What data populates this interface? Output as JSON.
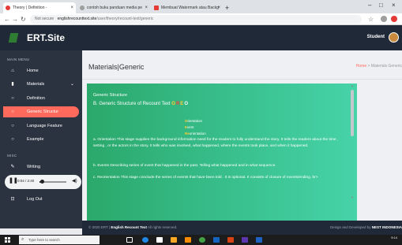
{
  "browser": {
    "tabs": [
      {
        "label": "Theory | Definition -",
        "active": true
      },
      {
        "label": "contoh buku panduan media pe",
        "active": false
      },
      {
        "label": "Membuat Watermark atau Backg",
        "active": false
      }
    ],
    "new_tab": "+",
    "url_warning": "Not secure",
    "url_host": "englishrecounttext.site",
    "url_path": "/user/theory/recount-text/generic"
  },
  "header": {
    "brand": "ERT.Site",
    "user_name": "Student"
  },
  "sidebar": {
    "section_main": "MAIN MENU",
    "items": [
      {
        "label": "Home",
        "icon": "home-icon"
      },
      {
        "label": "Materials",
        "icon": "document-icon"
      },
      {
        "label": "Definition",
        "icon": "circle-icon"
      },
      {
        "label": "Generic Structur",
        "icon": "circle-icon"
      },
      {
        "label": "Language Feature",
        "icon": "circle-icon"
      },
      {
        "label": "Example",
        "icon": "circle-icon"
      }
    ],
    "section_misc": "MISC",
    "writing_label": "Writing",
    "logout_label": "Log Out",
    "player_time": "0:04 / 2:40",
    "player_progress": 0.03
  },
  "main": {
    "title": "Materials|Generic",
    "breadcrumb_home": "Home",
    "breadcrumb_sep": ">",
    "breadcrumb_current": "Materials Generic",
    "card": {
      "heading": "Generic Structure",
      "sub_heading": "B. Generic Structure of Recount Text",
      "oreo": [
        "O",
        "R",
        "E",
        "O"
      ],
      "legend": [
        {
          "hl": "O",
          "rest": "rientation"
        },
        {
          "hl": "E",
          "rest": "vent"
        },
        {
          "hl": "Re",
          "rest": "orientation"
        }
      ],
      "para_orientation": "a. Orientation This stage supplies the background information need for the readers to fully understand the story. It tells the readers about the time , setting , or the actors in the story. It tells who was involved, what happened, where the events took place, and when it happened.",
      "para_events": "b. Events Describing series of event that happened in the past. Telling what happened and in what sequence.",
      "para_reorientation": "c. Reorientation This stage conclude the series of events that have been told . It is optional. It consists of closure of events/ending. br>",
      "scroll_fraction": 0.45
    }
  },
  "footer": {
    "left_prefix": "© 2020 ERT | ",
    "left_bold": "English Recount Text",
    "left_suffix": " All rights reserved.",
    "right_prefix": "Design and Developed by ",
    "right_bold": "NEST INDONESIA"
  },
  "taskbar": {
    "search_placeholder": "Type here to search",
    "clock_time": "9:14"
  },
  "colors": {
    "accent": "#ff6a5c",
    "header_bg": "#1f2937",
    "sidebar_bg": "#2b3240",
    "card_green": "#39c08e"
  }
}
